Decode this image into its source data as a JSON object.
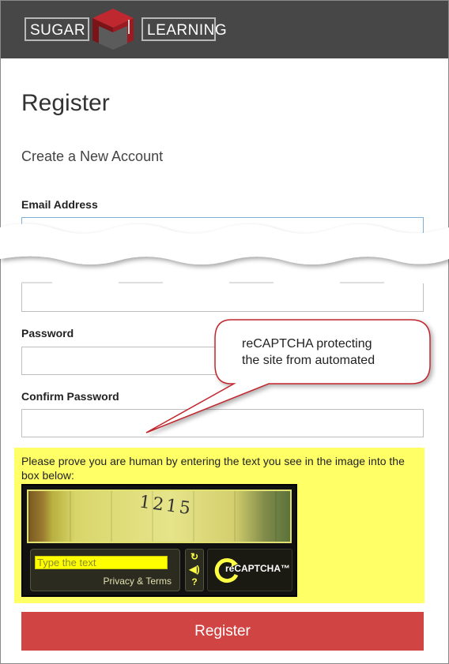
{
  "header": {
    "logo_left": "SUGAR",
    "logo_right": "LEARNING"
  },
  "page": {
    "title": "Register",
    "subtitle": "Create a New Account"
  },
  "form": {
    "email_label": "Email Address",
    "password_label": "Password",
    "confirm_label": "Confirm Password"
  },
  "captcha": {
    "prompt": "Please prove you are human by entering the text you see in the image into the box below:",
    "image_text": "1215",
    "input_placeholder": "Type the text",
    "privacy_terms": "Privacy & Terms",
    "logo_text": "reCAPTCHA™",
    "icons": [
      "refresh-icon",
      "audio-icon",
      "help-icon"
    ]
  },
  "callout": {
    "line1": "reCAPTCHA protecting",
    "line2": "the site from automated"
  },
  "register_button": "Register",
  "colors": {
    "header_bg": "#474747",
    "captcha_highlight": "#ffff66",
    "button": "#d04444",
    "accent_red": "#c0282f"
  }
}
